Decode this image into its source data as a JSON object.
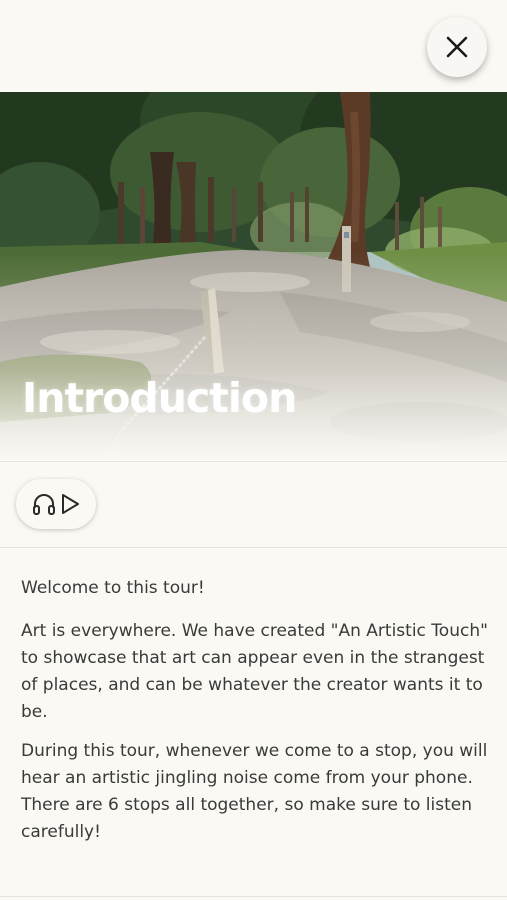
{
  "header": {
    "close_icon": "close-icon"
  },
  "hero": {
    "title": "Introduction",
    "image": "forest-gravel-path-photo"
  },
  "audio": {
    "icons": [
      "headphones-icon",
      "play-icon"
    ]
  },
  "content": {
    "paragraphs": [
      "Welcome to this tour!",
      "Art is everywhere. We have created \"An Artistic Touch\" to showcase that art can appear even in the strangest of places, and can be whatever the creator wants it to be.",
      "During this tour, whenever we come to a stop, you will hear an artistic jingling noise come from your phone. There are 6 stops all together, so make sure to listen carefully!"
    ]
  },
  "colors": {
    "background": "#faf9f4",
    "text": "#3a3a3a",
    "divider": "#e6e4de"
  }
}
